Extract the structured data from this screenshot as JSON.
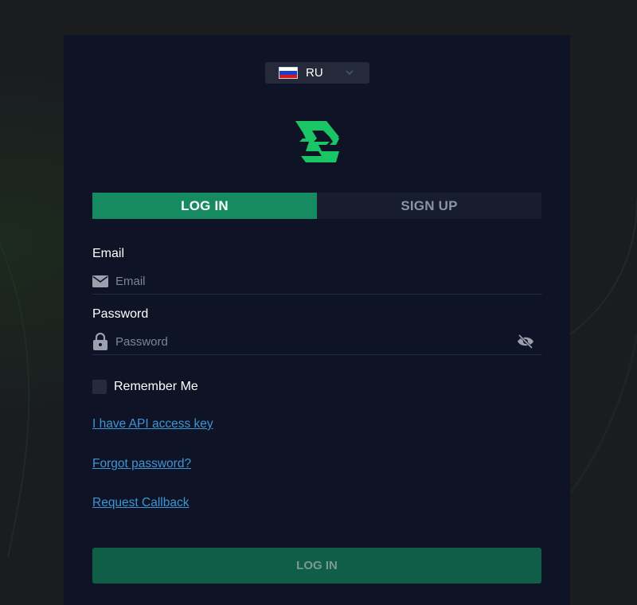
{
  "language": {
    "code": "RU",
    "flag_colors": [
      "#ffffff",
      "#1b3fcc",
      "#d8151b"
    ],
    "icon": "chevron-down-icon"
  },
  "logo": {
    "icon": "brand-logo",
    "color": "#19c565"
  },
  "tabs": [
    {
      "label": "LOG IN",
      "active": true
    },
    {
      "label": "SIGN UP",
      "active": false
    }
  ],
  "form": {
    "email": {
      "label": "Email",
      "placeholder": "Email",
      "value": "",
      "icon": "envelope-icon"
    },
    "password": {
      "label": "Password",
      "placeholder": "Password",
      "value": "",
      "icon": "lock-icon",
      "toggle_icon": "eye-off-icon"
    },
    "remember": {
      "label": "Remember Me",
      "checked": false
    }
  },
  "links": {
    "api_key": "I have API access key",
    "forgot": "Forgot password?",
    "callback": "Request Callback"
  },
  "submit_label": "LOG IN",
  "colors": {
    "accent": "#168a61",
    "submit_bg": "#105e47",
    "link": "#3e95d6",
    "panel": "#0e1425"
  }
}
